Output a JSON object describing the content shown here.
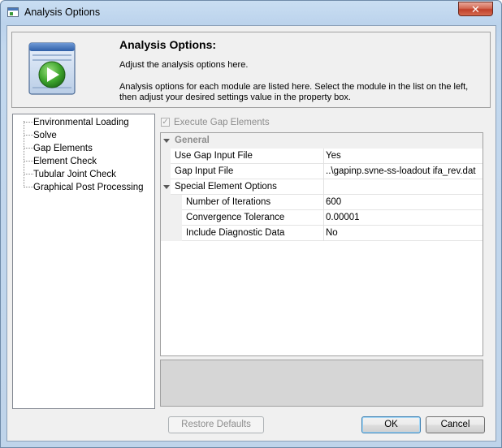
{
  "window": {
    "title": "Analysis Options",
    "close_glyph": "✕",
    "title_icon": "window-app-icon"
  },
  "header": {
    "icon": "play-window-icon",
    "title": "Analysis Options:",
    "subtitle": "Adjust the analysis options here.",
    "description": "Analysis options for each module are listed here. Select the module in the list on the left, then adjust your desired settings value in the property box."
  },
  "tree": {
    "items": [
      {
        "label": "Environmental Loading"
      },
      {
        "label": "Solve"
      },
      {
        "label": "Gap Elements"
      },
      {
        "label": "Element Check"
      },
      {
        "label": "Tubular Joint Check"
      },
      {
        "label": "Graphical Post Processing"
      }
    ]
  },
  "execute_checkbox": {
    "label": "Execute Gap Elements",
    "checked": true,
    "enabled": false,
    "check_glyph": "✓"
  },
  "property_grid": {
    "category": "General",
    "rows": [
      {
        "name": "Use Gap Input File",
        "value": "Yes"
      },
      {
        "name": "Gap Input File",
        "value": "..\\gapinp.svne-ss-loadout ifa_rev.dat"
      },
      {
        "name": "Special Element Options",
        "value": ""
      },
      {
        "name": "Number of Iterations",
        "value": "600"
      },
      {
        "name": "Convergence Tolerance",
        "value": "0.00001"
      },
      {
        "name": "Include Diagnostic Data",
        "value": "No"
      }
    ]
  },
  "buttons": {
    "restore_defaults": "Restore Defaults",
    "ok": "OK",
    "cancel": "Cancel"
  }
}
